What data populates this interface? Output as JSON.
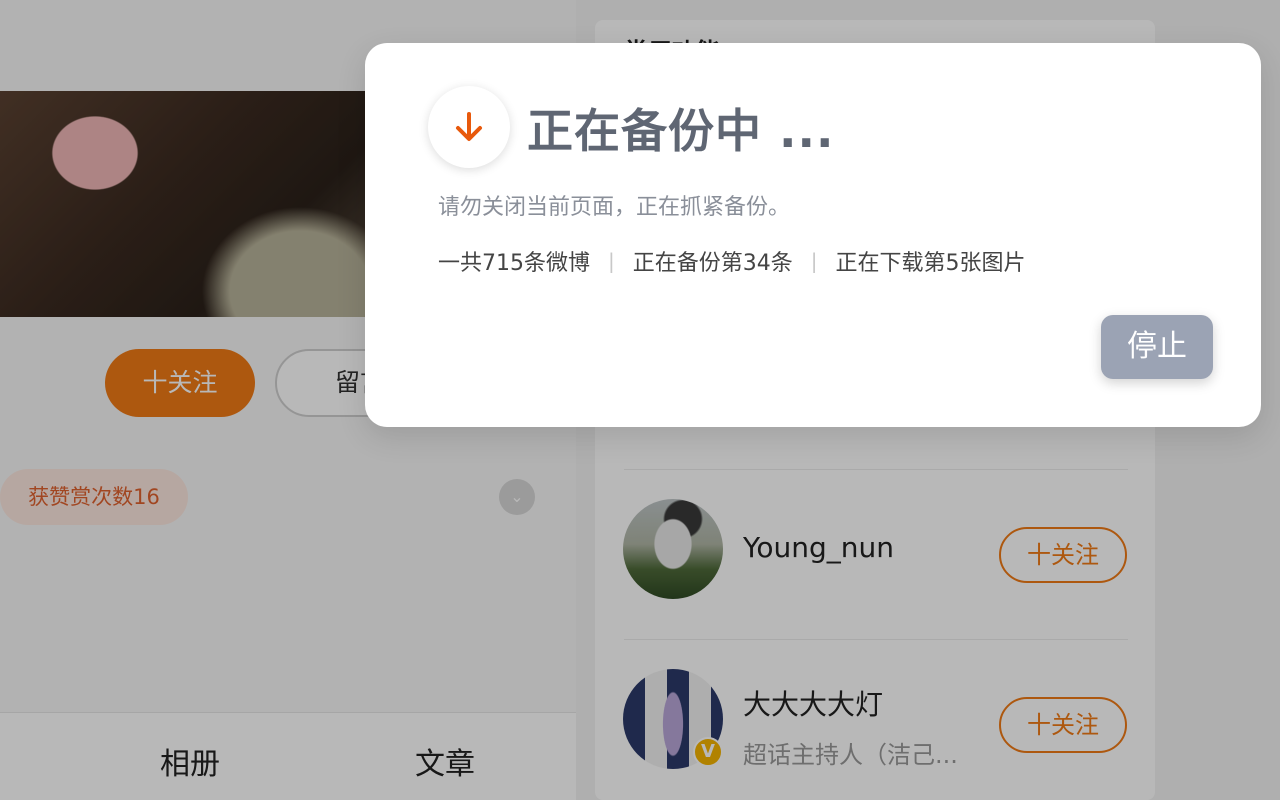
{
  "background": {
    "right_panel_title": "常用功能",
    "profile_actions": {
      "follow_label": "十关注",
      "message_label": "留言"
    },
    "reward_badge": "获赞赏次数16",
    "bottom_tabs": [
      "相册",
      "文章"
    ],
    "suggested_users": [
      {
        "name": "Young_nun",
        "desc": "",
        "follow_label": "十关注",
        "verified": false
      },
      {
        "name": "大大大大灯",
        "desc": "超话主持人（洁己...",
        "follow_label": "十关注",
        "verified": true,
        "verified_glyph": "V"
      }
    ]
  },
  "modal": {
    "title": "正在备份中 ...",
    "subtitle": "请勿关闭当前页面，正在抓紧备份。",
    "stats": {
      "total": "一共715条微博",
      "current": "正在备份第34条",
      "images": "正在下载第5张图片",
      "separator": "|"
    },
    "stop_label": "停止",
    "icon": "download-arrow-icon",
    "colors": {
      "accent": "#e8590c",
      "title": "#5f6673",
      "stop_button": "#9ba3b4"
    }
  }
}
